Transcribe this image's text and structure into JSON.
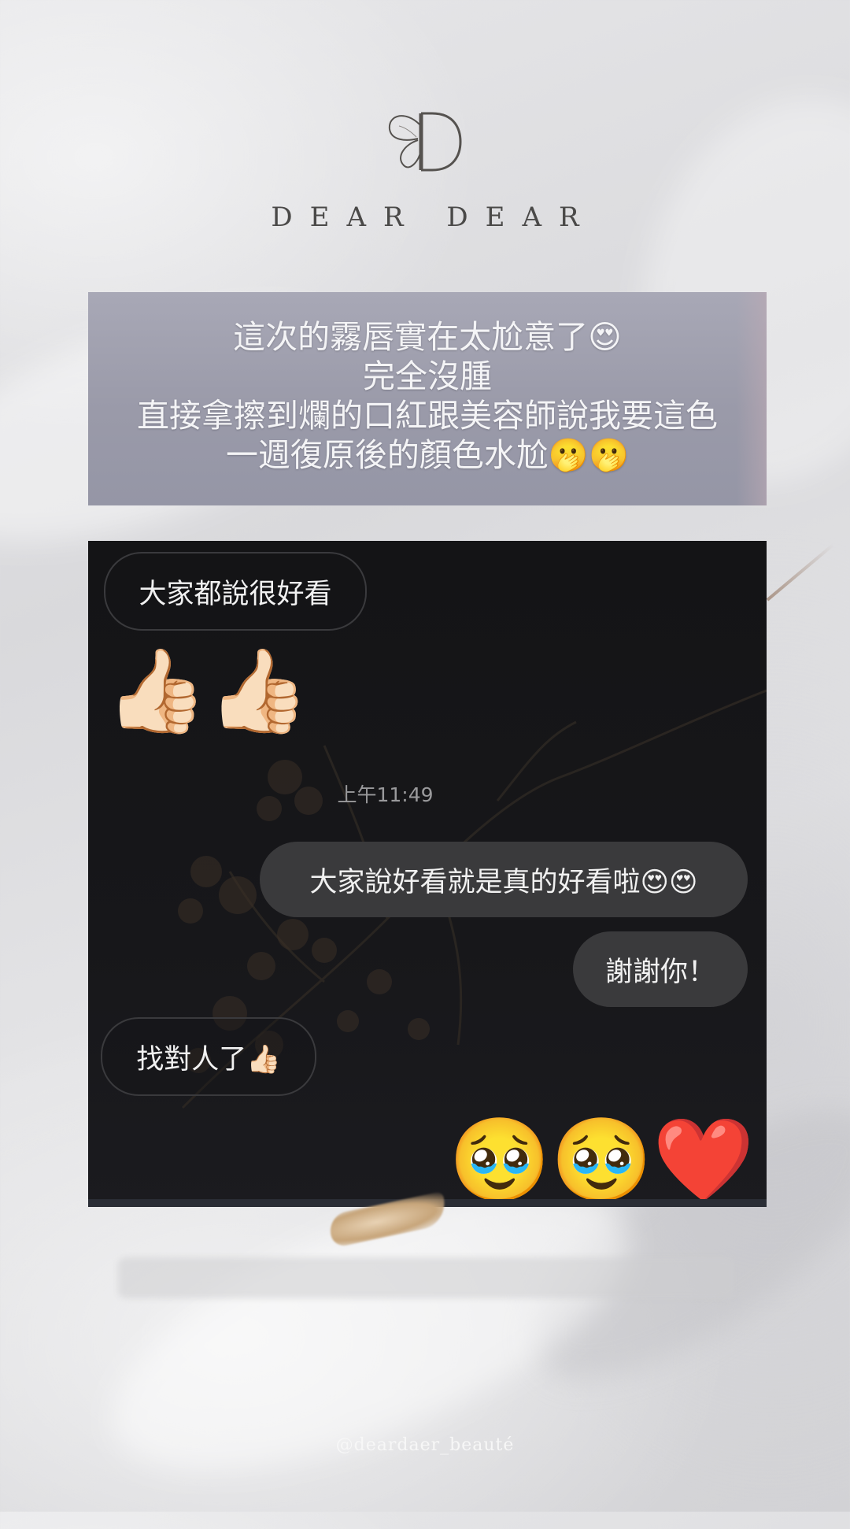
{
  "brand": {
    "logo_icon": "butterfly-d-monogram-icon",
    "name": "DEAR   DEAR"
  },
  "quote": {
    "lines": [
      "這次的霧唇實在太尬意了😍",
      "完全沒腫",
      "直接拿擦到爛的口紅跟美容師說我要這色",
      "一週復原後的顏色水尬🫢🫢"
    ]
  },
  "chat": {
    "messages": [
      {
        "direction": "incoming",
        "text": "大家都說很好看"
      },
      {
        "direction": "incoming",
        "type": "emoji",
        "text": "👍🏻👍🏻"
      },
      {
        "type": "timestamp",
        "text": "上午11:49"
      },
      {
        "direction": "outgoing",
        "text": "大家說好看就是真的好看啦😍😍"
      },
      {
        "direction": "outgoing",
        "text": "謝謝你！"
      },
      {
        "direction": "incoming",
        "text": "找對人了👍🏻"
      },
      {
        "direction": "incoming",
        "type": "emoji",
        "text": "🥹🥹❤️"
      }
    ]
  },
  "colors": {
    "chat_background": "#161618",
    "outgoing_bubble": "#3a3a3c",
    "incoming_bubble_border": "#3a3a3d",
    "quote_card": "#9a9aa9",
    "brand_text": "#4a4948"
  },
  "footer": {
    "handle": "@deardaer_beauté"
  }
}
